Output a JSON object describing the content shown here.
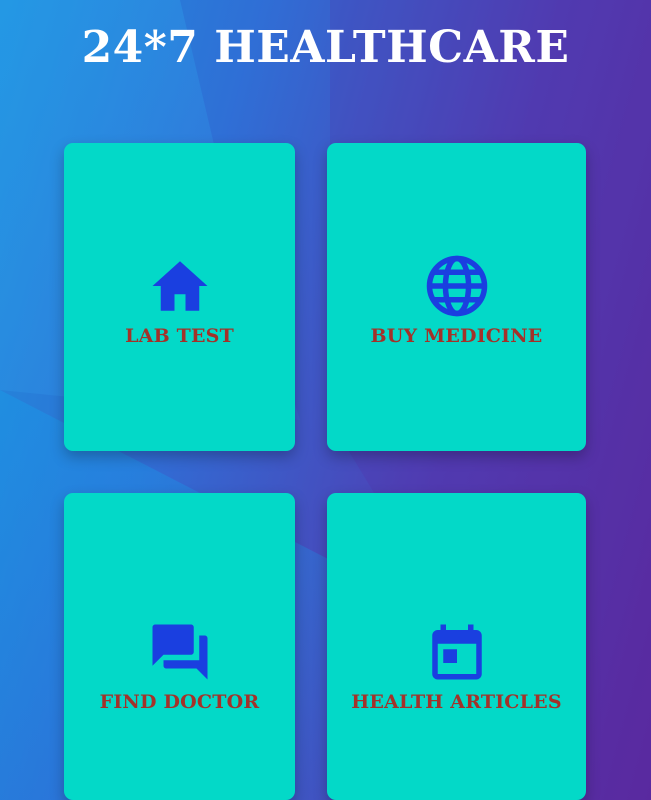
{
  "header": {
    "title": "24*7 HEALTHCARE"
  },
  "colors": {
    "card_background": "#03d9c8",
    "icon_color": "#1a3fe0",
    "label_color": "#a3322a",
    "title_color": "#ffffff"
  },
  "menu": [
    {
      "label": "LAB TEST",
      "icon": "home-icon"
    },
    {
      "label": "BUY MEDICINE",
      "icon": "globe-icon"
    },
    {
      "label": "FIND DOCTOR",
      "icon": "chat-icon"
    },
    {
      "label": "HEALTH ARTICLES",
      "icon": "calendar-icon"
    }
  ]
}
